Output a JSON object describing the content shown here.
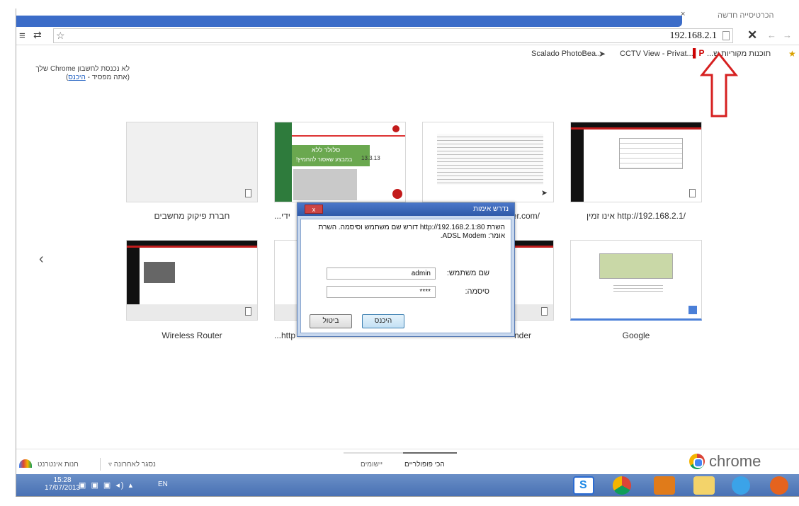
{
  "browser": {
    "tab_active_label": "",
    "tab_close": "×",
    "tab2_label": "הכרטיסייה חדשה",
    "url": "192.168.2.1",
    "bookmarks": {
      "apps": "תוכנות מקוריות ש...",
      "cctv": "CCTV View - Privat...",
      "scalado": "Scalado PhotoBea..."
    }
  },
  "signin": {
    "line1": "לא נכנסת לחשבון Chrome שלך",
    "line2_prefix": "(אתה מפסיד - ",
    "link": "היכנס",
    "line2_suffix": ")"
  },
  "thumbnails": [
    {
      "label": "חברת פיקוק מחשבים"
    },
    {
      "label": "...ידי"
    },
    {
      "label": "mer.com/"
    },
    {
      "label": "אינו זמין http://192.168.2.1/"
    },
    {
      "label": "Wireless Router"
    },
    {
      "label": "...http"
    },
    {
      "label": "nder"
    },
    {
      "label": "Google"
    }
  ],
  "promo": {
    "text1": "סלולר ללא",
    "text2": "במבצע שאסור להחמיץ!",
    "date": "13.3.13"
  },
  "dialog": {
    "title": "נדרש אימות",
    "close": "x",
    "message": "השרת http://192.168.2.1:80 דורש שם משתמש וסיסמה. השרת אומר: ADSL Modem.",
    "username_label": "שם משתמש:",
    "username_value": "admin",
    "password_label": "סיסמה:",
    "password_value": "****",
    "login_button": "היכנס",
    "cancel_button": "ביטול"
  },
  "footer": {
    "most_visited": "הכי פופולריים",
    "apps": "יישומים",
    "recently_closed": "נסגר לאחרונה ▿",
    "web_store": "חנות אינטרנט",
    "chrome_word": "chrome"
  },
  "taskbar": {
    "time": "15:28",
    "date": "17/07/2013",
    "lang": "EN"
  },
  "colors": {
    "tab_blue": "#3b6cc8",
    "annotation_red": "#d62020",
    "dialog_title": "#2f5aa8",
    "taskbar": "#4870b3"
  }
}
